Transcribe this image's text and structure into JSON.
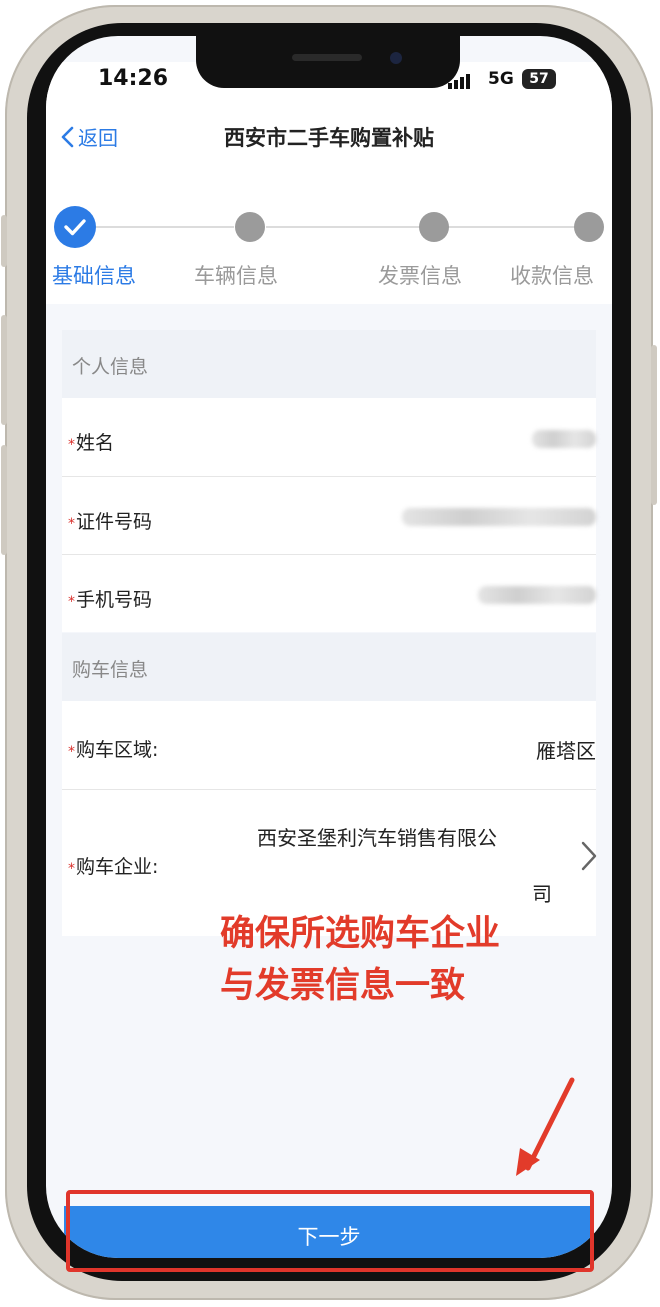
{
  "status_bar": {
    "time": "14:26",
    "network": "5G",
    "battery": "57"
  },
  "nav": {
    "back_label": "返回",
    "title": "西安市二手车购置补贴"
  },
  "steps": [
    {
      "label": "基础信息",
      "state": "done"
    },
    {
      "label": "车辆信息",
      "state": "pending"
    },
    {
      "label": "发票信息",
      "state": "pending"
    },
    {
      "label": "收款信息",
      "state": "pending"
    }
  ],
  "personal_section": {
    "title": "个人信息",
    "fields": [
      {
        "label": "姓名",
        "required": true,
        "value_blurred": true
      },
      {
        "label": "证件号码",
        "required": true,
        "value_blurred": true
      },
      {
        "label": "手机号码",
        "required": true,
        "value_blurred": true
      }
    ]
  },
  "purchase_section": {
    "title": "购车信息",
    "area": {
      "label": "购车区域:",
      "value": "雁塔区"
    },
    "company": {
      "label": "购车企业:",
      "value_line1": "西安圣堡利汽车销售有限公",
      "value_line2": "司"
    }
  },
  "annotation": {
    "line1": "确保所选购车企业",
    "line2": "与发票信息一致",
    "color": "#e23b2a"
  },
  "next_button": {
    "label": "下一步"
  },
  "colors": {
    "accent": "#2c7be5",
    "required_mark": "#d9302c"
  },
  "icons": {
    "back": "chevron-left-icon",
    "check": "check-icon",
    "row_chevron": "chevron-right-icon"
  }
}
